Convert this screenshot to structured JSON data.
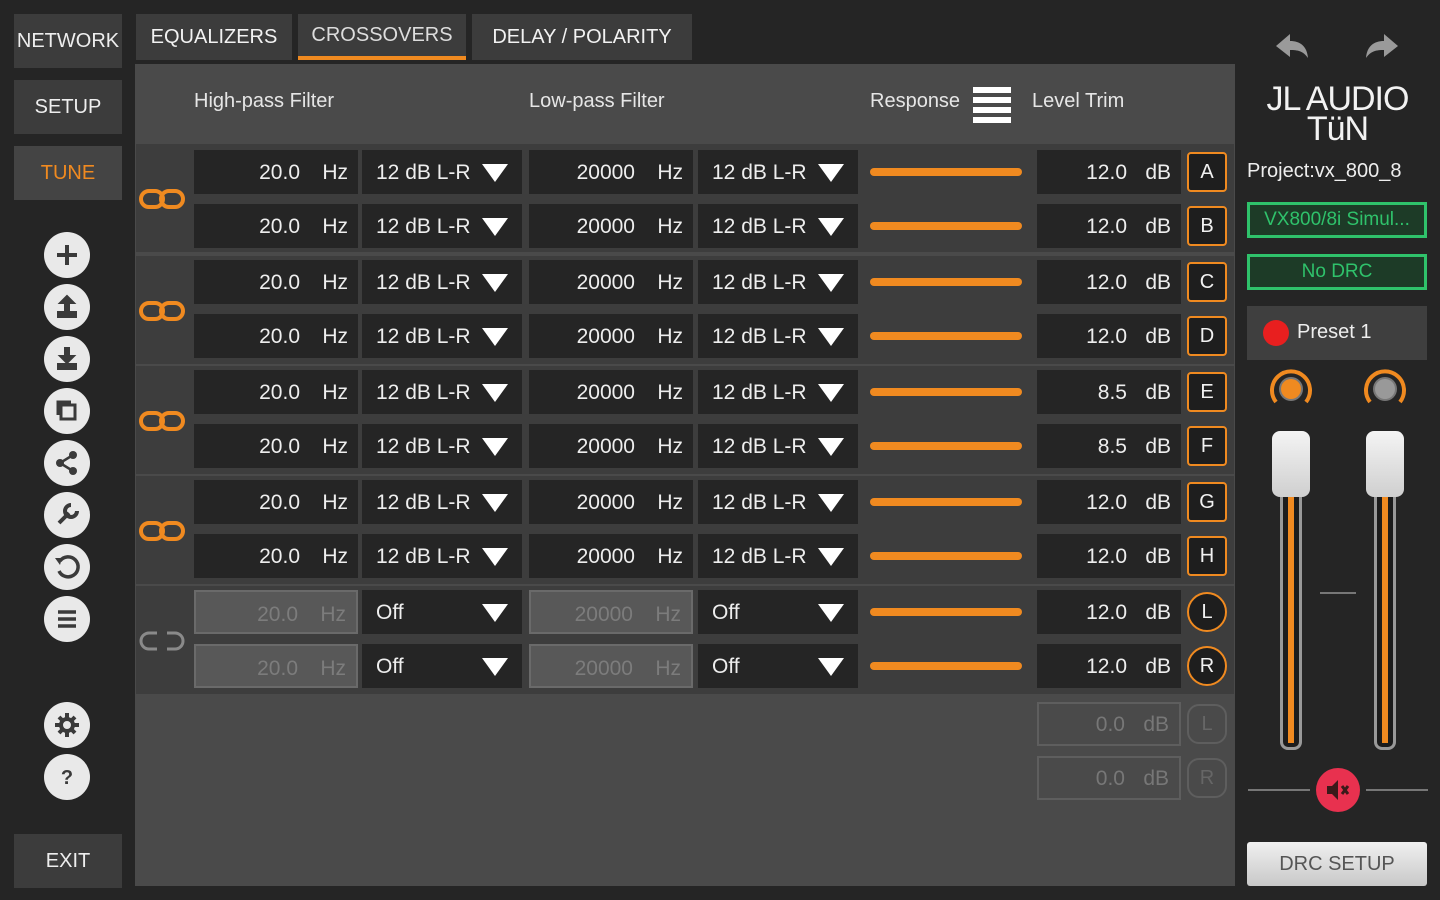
{
  "nav": {
    "network": "NETWORK",
    "setup": "SETUP",
    "tune": "TUNE",
    "exit": "EXIT"
  },
  "tools": [
    "add-icon",
    "upload-icon",
    "download-icon",
    "copy-icon",
    "share-icon",
    "wrench-icon",
    "undo-icon",
    "list-icon",
    "gear-icon",
    "help-icon"
  ],
  "tabs": {
    "equalizers": "EQUALIZERS",
    "crossovers": "CROSSOVERS",
    "delay": "DELAY / POLARITY"
  },
  "headers": {
    "hpf": "High-pass Filter",
    "lpf": "Low-pass Filter",
    "response": "Response",
    "level": "Level Trim"
  },
  "units": {
    "hz": "Hz",
    "db": "dB"
  },
  "channels": [
    {
      "id": "A",
      "hp_freq": "20.0",
      "hp_slope": "12 dB L-R",
      "lp_freq": "20000",
      "lp_slope": "12 dB L-R",
      "level": "12.0"
    },
    {
      "id": "B",
      "hp_freq": "20.0",
      "hp_slope": "12 dB L-R",
      "lp_freq": "20000",
      "lp_slope": "12 dB L-R",
      "level": "12.0"
    },
    {
      "id": "C",
      "hp_freq": "20.0",
      "hp_slope": "12 dB L-R",
      "lp_freq": "20000",
      "lp_slope": "12 dB L-R",
      "level": "12.0"
    },
    {
      "id": "D",
      "hp_freq": "20.0",
      "hp_slope": "12 dB L-R",
      "lp_freq": "20000",
      "lp_slope": "12 dB L-R",
      "level": "12.0"
    },
    {
      "id": "E",
      "hp_freq": "20.0",
      "hp_slope": "12 dB L-R",
      "lp_freq": "20000",
      "lp_slope": "12 dB L-R",
      "level": "8.5"
    },
    {
      "id": "F",
      "hp_freq": "20.0",
      "hp_slope": "12 dB L-R",
      "lp_freq": "20000",
      "lp_slope": "12 dB L-R",
      "level": "8.5"
    },
    {
      "id": "G",
      "hp_freq": "20.0",
      "hp_slope": "12 dB L-R",
      "lp_freq": "20000",
      "lp_slope": "12 dB L-R",
      "level": "12.0"
    },
    {
      "id": "H",
      "hp_freq": "20.0",
      "hp_slope": "12 dB L-R",
      "lp_freq": "20000",
      "lp_slope": "12 dB L-R",
      "level": "12.0"
    },
    {
      "id": "L",
      "hp_freq": "20.0",
      "hp_slope": "Off",
      "lp_freq": "20000",
      "lp_slope": "Off",
      "level": "12.0"
    },
    {
      "id": "R",
      "hp_freq": "20.0",
      "hp_slope": "Off",
      "lp_freq": "20000",
      "lp_slope": "Off",
      "level": "12.0"
    }
  ],
  "extra_outputs": [
    {
      "id": "L",
      "level": "0.0"
    },
    {
      "id": "R",
      "level": "0.0"
    }
  ],
  "right": {
    "logo_line1": "JL AUDIO",
    "logo_line2": "TüN",
    "project": "Project:vx_800_8",
    "device": "VX800/8i Simul...",
    "drc": "No DRC",
    "preset": "Preset 1",
    "drc_setup": "DRC SETUP"
  },
  "faders": {
    "left_level": 0.82,
    "right_level": 0.82
  },
  "colors": {
    "accent": "#f08a20",
    "green": "#2fc26b",
    "mute": "#e8314f",
    "preset_dot": "#e81f1f"
  }
}
